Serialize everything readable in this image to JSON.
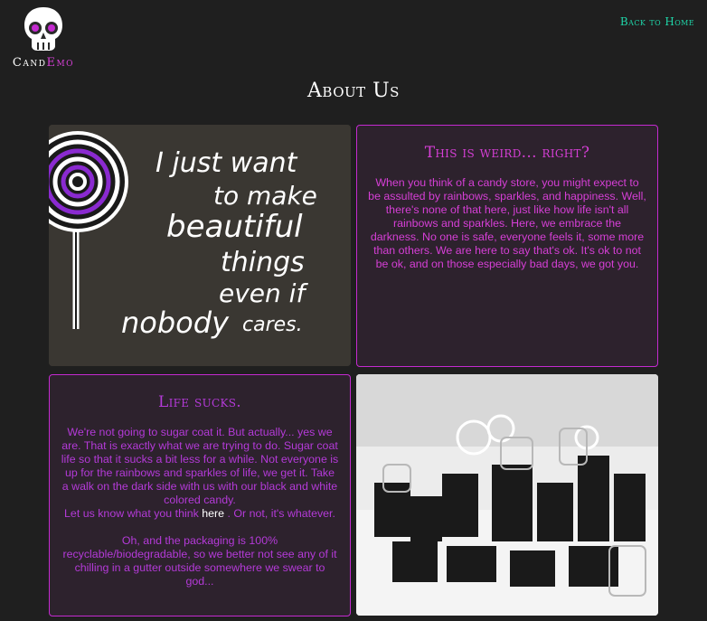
{
  "header": {
    "brand_cand": "Cand",
    "brand_emo": "Emo",
    "back_link": "Back to Home"
  },
  "page_title": "About Us",
  "lollipop_image": {
    "lines": [
      "I just want",
      "to make",
      "beautiful",
      "things",
      "even if",
      "nobody",
      "cares."
    ]
  },
  "card_weird": {
    "title": "This is weird... right?",
    "body": "When you think of a candy store, you might expect to be assulted by rainbows, sparkles, and happiness. Well, there's none of that here, just like how life isn't all rainbows and sparkles. Here, we embrace the darkness. No one is safe, everyone feels it, some more than others. We are here to say that's ok. It's ok to not be ok, and on those especially bad days, we got you."
  },
  "card_life": {
    "title": "Life sucks.",
    "body_1": "We're not going to sugar coat it. But actually... yes we are. That is exactly what we are trying to do. Sugar coat life so that it sucks a bit less for a while. Not everyone is up for the rainbows and sparkles of life, we get it. Take a walk on the dark side with us with our black and white colored candy.",
    "body_2_pre": "Let us know what you think ",
    "body_2_link": "here",
    "body_2_post": " . Or not, it's whatever.",
    "body_3": "Oh, and the packaging is 100% recyclable/biodegradable, so we better not see any of it chilling in a gutter outside somewhere we swear to god..."
  },
  "colors": {
    "background": "#1f1f1f",
    "accent_magenta": "#d63fd6",
    "accent_teal": "#1fd6a9",
    "card_bg": "#2d222d"
  }
}
